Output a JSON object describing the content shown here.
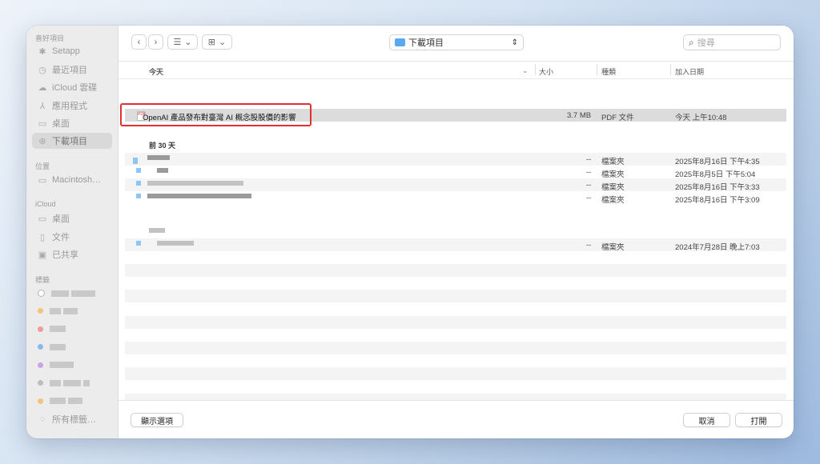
{
  "sidebar": {
    "favorites_header": "喜好項目",
    "favorites": [
      {
        "label": "Setapp",
        "icon": "setapp-icon",
        "glyph": "✱"
      },
      {
        "label": "最近項目",
        "icon": "clock-icon",
        "glyph": "◷"
      },
      {
        "label": "iCloud 雲碟",
        "icon": "cloud-icon",
        "glyph": "☁"
      },
      {
        "label": "應用程式",
        "icon": "applications-icon",
        "glyph": "⅄"
      },
      {
        "label": "桌面",
        "icon": "desktop-icon",
        "glyph": "▭"
      },
      {
        "label": "下載項目",
        "icon": "download-icon",
        "glyph": "⊕",
        "selected": true
      }
    ],
    "locations_header": "位置",
    "locations": [
      {
        "label": "Macintosh…",
        "icon": "disk-icon",
        "glyph": "▭"
      }
    ],
    "icloud_header": "iCloud",
    "icloud": [
      {
        "label": "桌面",
        "icon": "desktop-icon",
        "glyph": "▭"
      },
      {
        "label": "文件",
        "icon": "document-icon",
        "glyph": "▯"
      },
      {
        "label": "已共享",
        "icon": "shared-folder-icon",
        "glyph": "▣"
      }
    ],
    "tags_header": "標籤",
    "tag_colors": [
      "#ffffff",
      "#f5c27a",
      "#f29a9a",
      "#8ab8ef",
      "#c9a3e3",
      "#bdbdbd",
      "#f5c27a"
    ],
    "all_tags": "所有標籤…"
  },
  "toolbar": {
    "back_glyph": "‹",
    "forward_glyph": "›",
    "view_glyph": "☰",
    "group_glyph": "⊞",
    "chevron": "⌄",
    "location": "下載項目",
    "updown_glyph": "⇕",
    "search_placeholder": "搜尋",
    "search_glyph": "⌕"
  },
  "columns": {
    "name": "今天",
    "size": "大小",
    "kind": "種類",
    "date_added": "加入日期"
  },
  "today_file": {
    "name": "OpenAI 產品發布對臺灣 AI 概念股股價的影響",
    "size": "3.7 MB",
    "kind": "PDF 文件",
    "date": "今天 上午10:48",
    "icon_text": "PDF"
  },
  "group_30days": "前 30 天",
  "rows_30days": [
    {
      "size": "--",
      "kind": "檔案夾",
      "date": "2025年8月16日 下午4:35"
    },
    {
      "size": "--",
      "kind": "檔案夾",
      "date": "2025年8月5日 下午5:04"
    },
    {
      "size": "--",
      "kind": "檔案夾",
      "date": "2025年8月16日 下午3:33"
    },
    {
      "size": "--",
      "kind": "檔案夾",
      "date": "2025年8月16日 下午3:09"
    }
  ],
  "older_row": {
    "size": "--",
    "kind": "檔案夾",
    "date": "2024年7月28日 晚上7:03"
  },
  "footer": {
    "options": "顯示選項",
    "cancel": "取消",
    "open": "打開"
  },
  "colors": {
    "highlight": "#e03030",
    "folder_blue": "#5aa9f0"
  }
}
